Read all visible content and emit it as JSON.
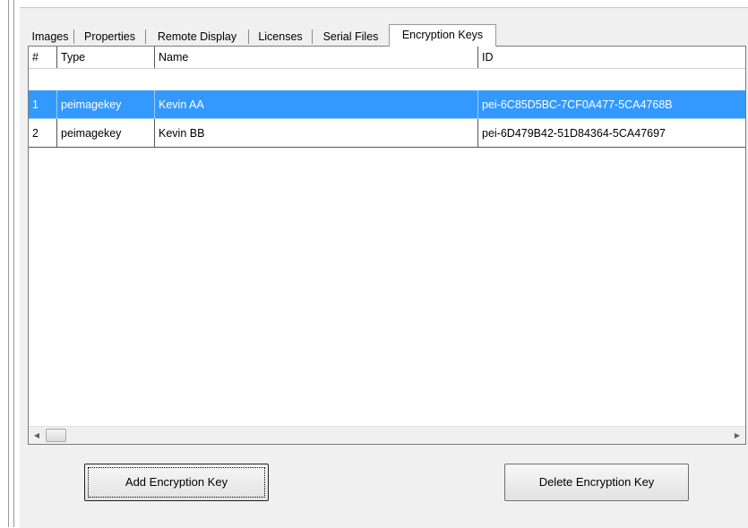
{
  "tabs": [
    {
      "label": "Images"
    },
    {
      "label": "Properties"
    },
    {
      "label": "Remote Display"
    },
    {
      "label": "Licenses"
    },
    {
      "label": "Serial Files"
    },
    {
      "label": "Encryption Keys",
      "active": true
    }
  ],
  "table": {
    "columns": [
      "#",
      "Type",
      "Name",
      "ID"
    ],
    "rows": [
      {
        "num": "1",
        "type": "peimagekey",
        "name": "Kevin AA",
        "id": "pei-6C85D5BC-7CF0A477-5CA4768B",
        "selected": true
      },
      {
        "num": "2",
        "type": "peimagekey",
        "name": "Kevin BB",
        "id": "pei-6D479B42-51D84364-5CA47697",
        "selected": false
      }
    ]
  },
  "scrollbar": {
    "left_icon": "scroll-left-arrow-icon",
    "right_icon": "scroll-right-arrow-icon"
  },
  "buttons": {
    "add": "Add Encryption Key",
    "delete": "Delete Encryption Key"
  },
  "colors": {
    "selection": "#3399ff",
    "panel": "#f0f0f0"
  }
}
